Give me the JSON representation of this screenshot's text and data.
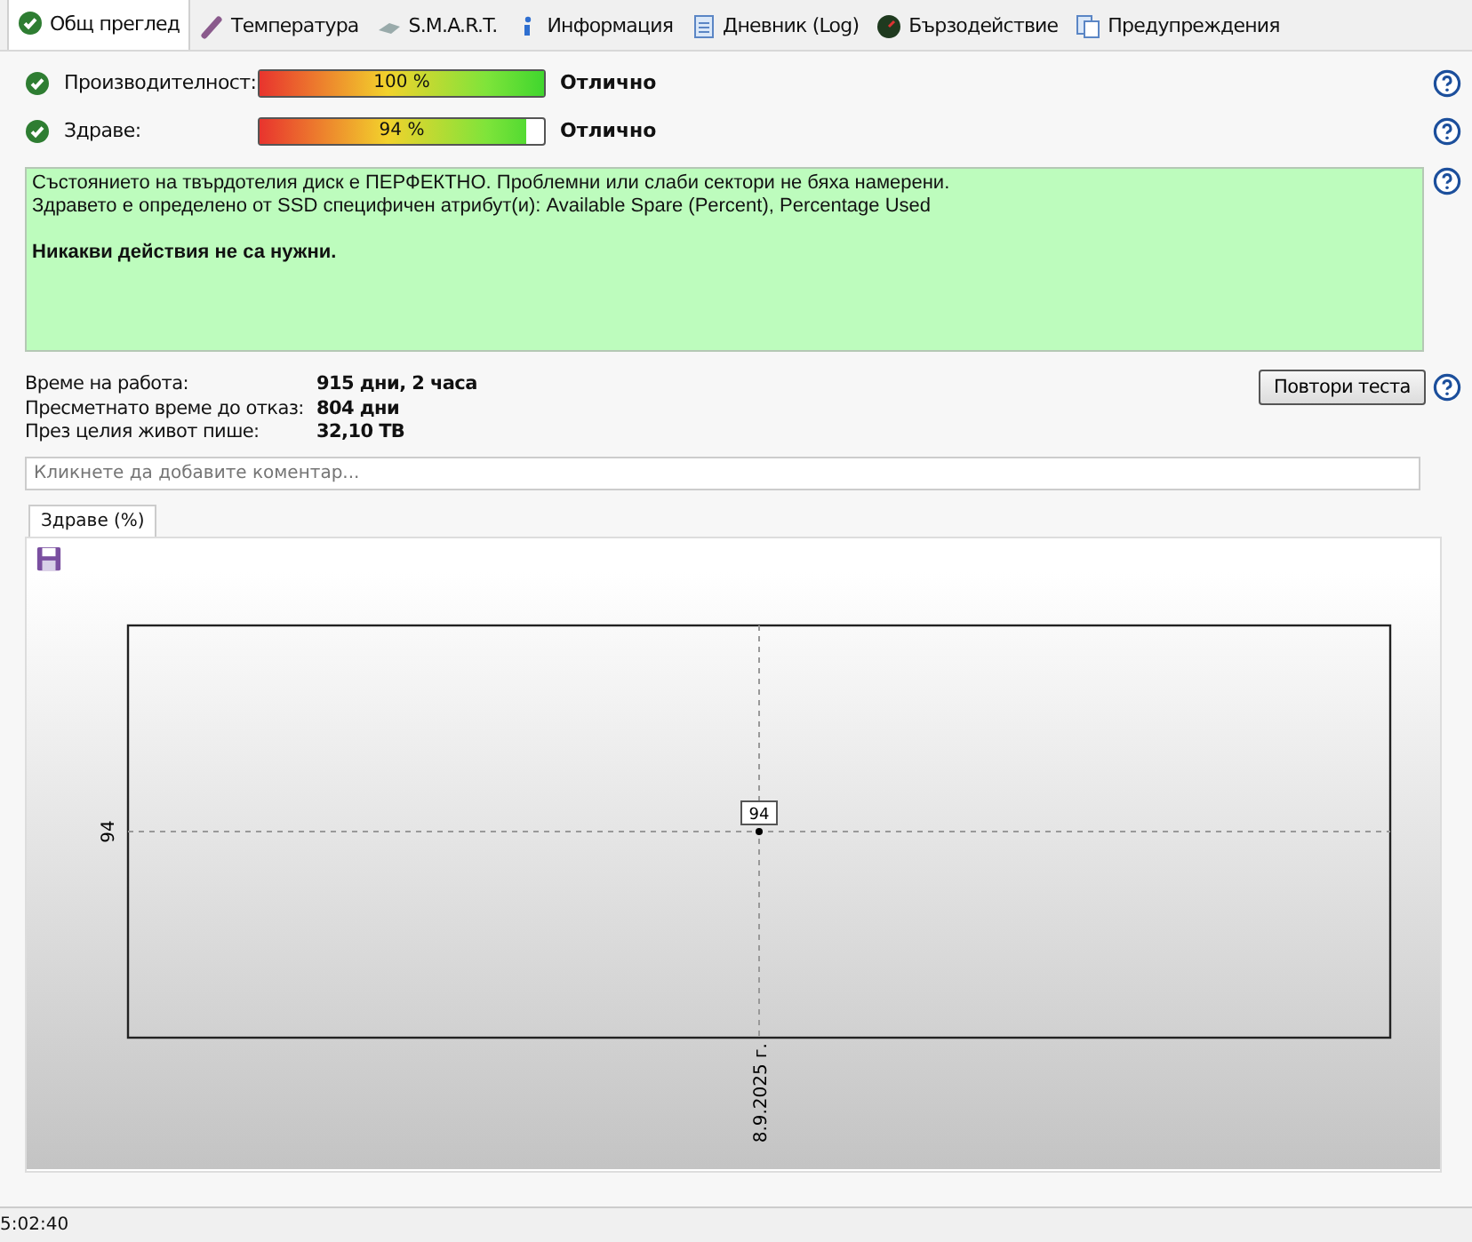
{
  "tabs": [
    {
      "label": "Общ преглед",
      "selected": true
    },
    {
      "label": "Температура",
      "selected": false
    },
    {
      "label": "S.M.A.R.T.",
      "selected": false
    },
    {
      "label": "Информация",
      "selected": false
    },
    {
      "label": "Дневник (Log)",
      "selected": false
    },
    {
      "label": "Бързодействие",
      "selected": false
    },
    {
      "label": "Предупреждения",
      "selected": false
    }
  ],
  "meters": [
    {
      "label": "Производителност:",
      "level": 1.0,
      "reading": "100 %",
      "verdict": "Отлично"
    },
    {
      "label": "Здраве:",
      "level": 0.94,
      "reading": "94 %",
      "verdict": "Отлично"
    }
  ],
  "status_box": {
    "lines": [
      "Състоянието на твърдотелия диск е ПЕРФЕКТНО. Проблемни или слаби сектори не бяха намерени.",
      "Здравето е определено от SSD специфичен атрибут(и):  Available Spare (Percent), Percentage Used"
    ],
    "conclusion": "Никакви действия не са нужни."
  },
  "stats": [
    {
      "label": "Време на работа:",
      "value": "915 дни, 2 часа"
    },
    {
      "label": "Пресметнато време до отказ:",
      "value": "804 дни"
    },
    {
      "label": "През целия живот пише:",
      "value": "32,10 TB"
    }
  ],
  "retest_button": "Повтори теста",
  "comment": {
    "placeholder": "Кликнете да добавите коментар..."
  },
  "chart_tabs": [
    {
      "label": "Здраве (%)",
      "selected": true
    }
  ],
  "chart": {
    "y_tick": "94",
    "x_tick": "8.9.2025 г.",
    "point_label": "94"
  },
  "status_bar": "5:02:40"
}
